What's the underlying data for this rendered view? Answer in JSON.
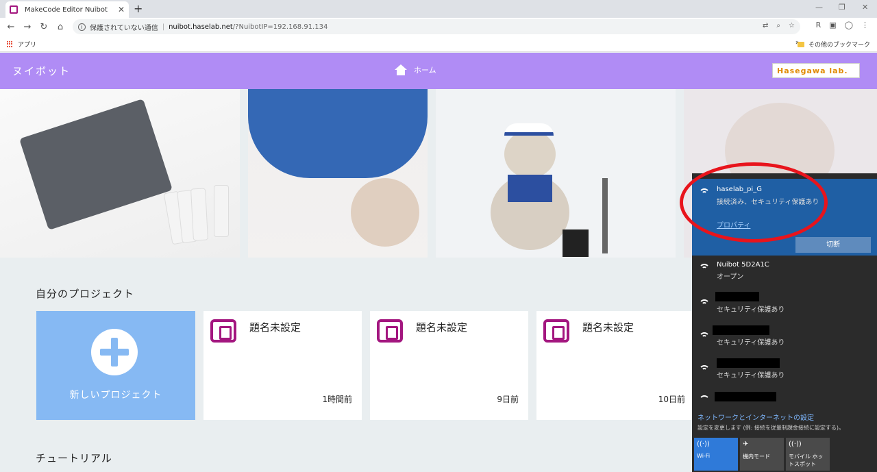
{
  "browser": {
    "tab_title": "MakeCode Editor Nuibot",
    "tab_close": "✕",
    "new_tab": "+",
    "win_minimize": "—",
    "win_restore": "❐",
    "win_close": "✕",
    "security_label": "保護されていない通信",
    "url_host": "nuibot.haselab.net",
    "url_path": "/?NuibotIP=192.168.91.134",
    "bookmark_apps": "アプリ",
    "bookmark_more": "»",
    "bookmark_other": "その他のブックマーク"
  },
  "app": {
    "brand": "ヌイボット",
    "home_label": "ホーム",
    "lab_logo_text": "Hasegawa lab."
  },
  "projects": {
    "section_title": "自分のプロジェクト",
    "new_project_label": "新しいプロジェクト",
    "cards": [
      {
        "title": "題名未設定",
        "time": "1時間前"
      },
      {
        "title": "題名未設定",
        "time": "9日前"
      },
      {
        "title": "題名未設定",
        "time": "10日前"
      }
    ]
  },
  "tutorials": {
    "section_title": "チュートリアル"
  },
  "wifi": {
    "active": {
      "name": "haselab_pi_G",
      "status": "接続済み、セキュリティ保護あり",
      "properties_link": "プロパティ",
      "disconnect_label": "切断"
    },
    "networks": [
      {
        "name": "Nuibot 5D2A1C",
        "status": "オープン"
      },
      {
        "name": "",
        "status": "セキュリティ保護あり"
      },
      {
        "name": "",
        "status": "セキュリティ保護あり"
      },
      {
        "name": "",
        "status": "セキュリティ保護あり"
      }
    ],
    "settings_link": "ネットワークとインターネットの設定",
    "settings_desc": "設定を変更します (例: 接続を従量制課金接続に設定する)。",
    "tiles": [
      {
        "label": "Wi-Fi",
        "icon": "wifi-icon"
      },
      {
        "label": "機内モード",
        "icon": "airplane-icon"
      },
      {
        "label": "モバイル ホットスポット",
        "icon": "hotspot-icon"
      }
    ]
  },
  "colors": {
    "appbar": "#b08cf5",
    "new_project_card": "#86b9f3",
    "makecode_magenta": "#a3167f",
    "wifi_active": "#1f5fa4",
    "annotation_red": "#e8141c"
  }
}
